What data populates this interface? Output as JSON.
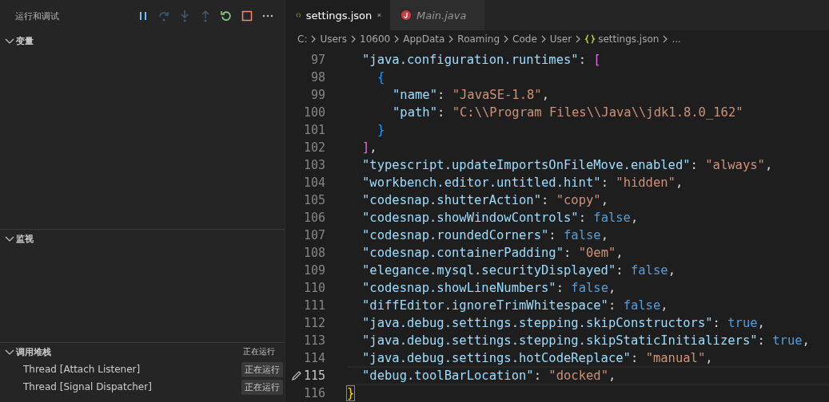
{
  "sidebar": {
    "title": "运行和调试",
    "toolbar": [
      {
        "kind": "pause",
        "disabled": false
      },
      {
        "kind": "step-over",
        "disabled": true
      },
      {
        "kind": "step-into",
        "disabled": true
      },
      {
        "kind": "step-out",
        "disabled": true
      },
      {
        "kind": "restart",
        "disabled": false
      },
      {
        "kind": "stop",
        "disabled": false
      },
      {
        "kind": "more",
        "disabled": false
      }
    ],
    "sections": [
      {
        "title": "变量",
        "expanded": true
      },
      {
        "title": "监视",
        "expanded": true
      },
      {
        "title": "调用堆栈",
        "expanded": true,
        "status": "正在运行",
        "threads": [
          {
            "name": "Thread [Attach Listener]",
            "status": "正在运行"
          },
          {
            "name": "Thread [Signal Dispatcher]",
            "status": "正在运行"
          }
        ]
      }
    ]
  },
  "editor": {
    "tabs": [
      {
        "label": "settings.json",
        "kind": "json",
        "selected": true,
        "preview": false
      },
      {
        "label": "Main.java",
        "kind": "java",
        "selected": false,
        "preview": true
      }
    ],
    "breadcrumbs": [
      {
        "label": "C:",
        "kind": "folder"
      },
      {
        "label": "Users",
        "kind": "folder"
      },
      {
        "label": "10600",
        "kind": "folder"
      },
      {
        "label": "AppData",
        "kind": "folder"
      },
      {
        "label": "Roaming",
        "kind": "folder"
      },
      {
        "label": "Code",
        "kind": "folder"
      },
      {
        "label": "User",
        "kind": "folder"
      },
      {
        "label": "settings.json",
        "kind": "json"
      },
      {
        "label": "...",
        "kind": "more"
      }
    ],
    "lines": [
      {
        "number": "97",
        "current": false,
        "tokens": [
          {
            "kind": "key",
            "text": "\"java.configuration.runtimes\""
          },
          {
            "kind": "punct",
            "text": ": "
          },
          {
            "kind": "bracket2",
            "text": "["
          }
        ],
        "children": [
          {
            "number": "98",
            "current": false,
            "tokens": [
              {
                "kind": "bracket3",
                "text": "{"
              }
            ],
            "children": [
              {
                "number": "99",
                "current": false,
                "tokens": [
                  {
                    "kind": "key",
                    "text": "\"name\""
                  },
                  {
                    "kind": "punct",
                    "text": ": "
                  },
                  {
                    "kind": "string",
                    "text": "\"JavaSE-1.8\""
                  },
                  {
                    "kind": "punct",
                    "text": ","
                  }
                ]
              },
              {
                "number": "100",
                "current": false,
                "tokens": [
                  {
                    "kind": "key",
                    "text": "\"path\""
                  },
                  {
                    "kind": "punct",
                    "text": ": "
                  },
                  {
                    "kind": "string",
                    "text": "\"C:\\\\Program Files\\\\Java\\\\jdk1.8.0_162\""
                  }
                ]
              }
            ]
          },
          {
            "number": "101",
            "current": false,
            "tokens": [
              {
                "kind": "bracket3",
                "text": "}"
              }
            ]
          }
        ]
      },
      {
        "number": "102",
        "current": false,
        "tokens": [
          {
            "kind": "bracket2",
            "text": "]"
          },
          {
            "kind": "punct",
            "text": ","
          }
        ]
      },
      {
        "number": "103",
        "current": false,
        "tokens": [
          {
            "kind": "key",
            "text": "\"typescript.updateImportsOnFileMove.enabled\""
          },
          {
            "kind": "punct",
            "text": ": "
          },
          {
            "kind": "string",
            "text": "\"always\""
          },
          {
            "kind": "punct",
            "text": ","
          }
        ]
      },
      {
        "number": "104",
        "current": false,
        "tokens": [
          {
            "kind": "key",
            "text": "\"workbench.editor.untitled.hint\""
          },
          {
            "kind": "punct",
            "text": ": "
          },
          {
            "kind": "string",
            "text": "\"hidden\""
          },
          {
            "kind": "punct",
            "text": ","
          }
        ]
      },
      {
        "number": "105",
        "current": false,
        "tokens": [
          {
            "kind": "key",
            "text": "\"codesnap.shutterAction\""
          },
          {
            "kind": "punct",
            "text": ": "
          },
          {
            "kind": "string",
            "text": "\"copy\""
          },
          {
            "kind": "punct",
            "text": ","
          }
        ]
      },
      {
        "number": "106",
        "current": false,
        "tokens": [
          {
            "kind": "key",
            "text": "\"codesnap.showWindowControls\""
          },
          {
            "kind": "punct",
            "text": ": "
          },
          {
            "kind": "keyword",
            "text": "false"
          },
          {
            "kind": "punct",
            "text": ","
          }
        ]
      },
      {
        "number": "107",
        "current": false,
        "tokens": [
          {
            "kind": "key",
            "text": "\"codesnap.roundedCorners\""
          },
          {
            "kind": "punct",
            "text": ": "
          },
          {
            "kind": "keyword",
            "text": "false"
          },
          {
            "kind": "punct",
            "text": ","
          }
        ]
      },
      {
        "number": "108",
        "current": false,
        "tokens": [
          {
            "kind": "key",
            "text": "\"codesnap.containerPadding\""
          },
          {
            "kind": "punct",
            "text": ": "
          },
          {
            "kind": "string",
            "text": "\"0em\""
          },
          {
            "kind": "punct",
            "text": ","
          }
        ]
      },
      {
        "number": "109",
        "current": false,
        "tokens": [
          {
            "kind": "key",
            "text": "\"elegance.mysql.securityDisplayed\""
          },
          {
            "kind": "punct",
            "text": ": "
          },
          {
            "kind": "keyword",
            "text": "false"
          },
          {
            "kind": "punct",
            "text": ","
          }
        ]
      },
      {
        "number": "110",
        "current": false,
        "tokens": [
          {
            "kind": "key",
            "text": "\"codesnap.showLineNumbers\""
          },
          {
            "kind": "punct",
            "text": ": "
          },
          {
            "kind": "keyword",
            "text": "false"
          },
          {
            "kind": "punct",
            "text": ","
          }
        ]
      },
      {
        "number": "111",
        "current": false,
        "tokens": [
          {
            "kind": "key",
            "text": "\"diffEditor.ignoreTrimWhitespace\""
          },
          {
            "kind": "punct",
            "text": ": "
          },
          {
            "kind": "keyword",
            "text": "false"
          },
          {
            "kind": "punct",
            "text": ","
          }
        ]
      },
      {
        "number": "112",
        "current": false,
        "tokens": [
          {
            "kind": "key",
            "text": "\"java.debug.settings.stepping.skipConstructors\""
          },
          {
            "kind": "punct",
            "text": ": "
          },
          {
            "kind": "keyword",
            "text": "true"
          },
          {
            "kind": "punct",
            "text": ","
          }
        ]
      },
      {
        "number": "113",
        "current": false,
        "tokens": [
          {
            "kind": "key",
            "text": "\"java.debug.settings.stepping.skipStaticInitializers\""
          },
          {
            "kind": "punct",
            "text": ": "
          },
          {
            "kind": "keyword",
            "text": "true"
          },
          {
            "kind": "punct",
            "text": ","
          }
        ]
      },
      {
        "number": "114",
        "current": false,
        "tokens": [
          {
            "kind": "key",
            "text": "\"java.debug.settings.hotCodeReplace\""
          },
          {
            "kind": "punct",
            "text": ": "
          },
          {
            "kind": "string",
            "text": "\"manual\""
          },
          {
            "kind": "punct",
            "text": ","
          }
        ]
      },
      {
        "number": "115",
        "current": true,
        "tokens": [
          {
            "kind": "key",
            "text": "\"debug.toolBarLocation\""
          },
          {
            "kind": "punct",
            "text": ": "
          },
          {
            "kind": "string",
            "text": "\"docked\""
          },
          {
            "kind": "punct",
            "text": ","
          }
        ]
      }
    ],
    "closing_line": {
      "number": "116",
      "current": false,
      "tokens": [
        {
          "kind": "bracket1",
          "text": "}"
        }
      ]
    }
  }
}
